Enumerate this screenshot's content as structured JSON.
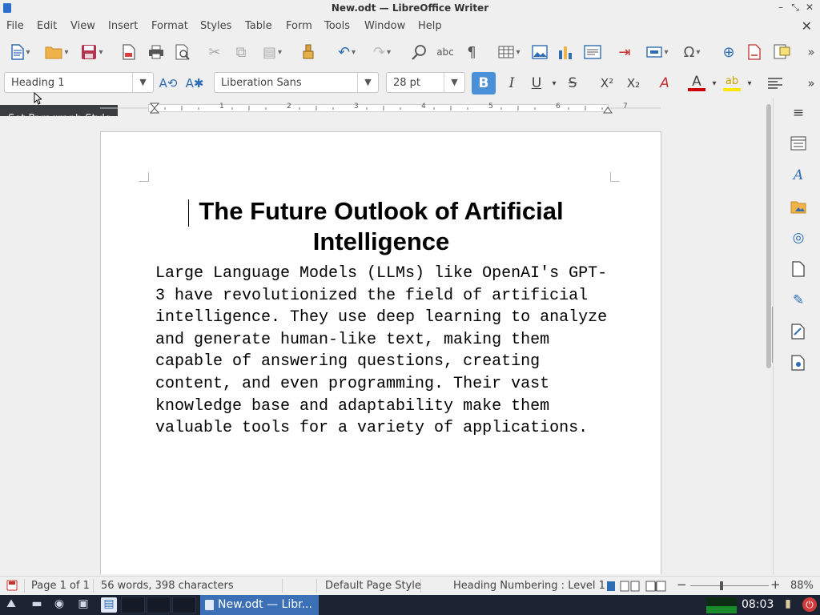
{
  "window": {
    "title": "New.odt — LibreOffice Writer",
    "controls": [
      "–",
      "⤡",
      "✕"
    ]
  },
  "menu": {
    "items": [
      "File",
      "Edit",
      "View",
      "Insert",
      "Format",
      "Styles",
      "Table",
      "Form",
      "Tools",
      "Window",
      "Help"
    ],
    "close_document": "✕"
  },
  "toolbar_standard": {
    "icons": [
      "new-document-icon",
      "open-folder-icon",
      "save-icon",
      "export-pdf-icon",
      "print-icon",
      "print-preview-icon",
      "cut-icon",
      "copy-icon",
      "paste-icon",
      "clone-formatting-icon",
      "undo-icon",
      "redo-icon",
      "find-replace-icon",
      "spelling-icon",
      "formatting-marks-icon",
      "insert-table-icon",
      "insert-image-icon",
      "insert-chart-icon",
      "insert-textbox-icon",
      "page-break-icon",
      "insert-field-icon",
      "special-character-icon",
      "hyperlink-icon",
      "footnote-icon",
      "comment-icon",
      "more-icon"
    ]
  },
  "toolbar_formatting": {
    "paragraph_style": "Heading 1",
    "font_name": "Liberation Sans",
    "font_size": "28 pt",
    "bold": "B",
    "italic": "I",
    "underline": "U",
    "strikethrough": "S",
    "superscript": "X²",
    "subscript": "X₂",
    "clear_formatting": "A",
    "font_color": "A",
    "font_color_value": "#cc0000",
    "highlight_value": "#ffe800",
    "accent": "#4a90d9"
  },
  "tooltip": {
    "text": "Set Paragraph Style"
  },
  "ruler": {
    "numbers": [
      "1",
      "2",
      "3",
      "4",
      "5",
      "6",
      "7"
    ]
  },
  "document": {
    "heading": "The Future Outlook of Artificial Intelligence",
    "body": "Large Language Models (LLMs) like OpenAI's GPT-3 have revolutionized the field of artificial intelligence. They use deep learning to analyze and generate human-like text, making them capable of answering questions, creating content, and even programming. Their vast knowledge base and adaptability make them valuable tools for a variety of applications."
  },
  "sidebar": {
    "icons": [
      "sidebar-menu-icon",
      "properties-icon",
      "styles-icon",
      "gallery-icon",
      "navigator-icon",
      "page-icon",
      "style-inspector-icon",
      "manage-changes-icon",
      "design-icon"
    ]
  },
  "statusbar": {
    "page": "Page 1 of 1",
    "word_count": "56 words, 398 characters",
    "page_style": "Default Page Style",
    "outline": "Heading Numbering : Level 1",
    "zoom": "88%"
  },
  "taskbar": {
    "task_label": "New.odt — Libr...",
    "clock": "08:03"
  }
}
